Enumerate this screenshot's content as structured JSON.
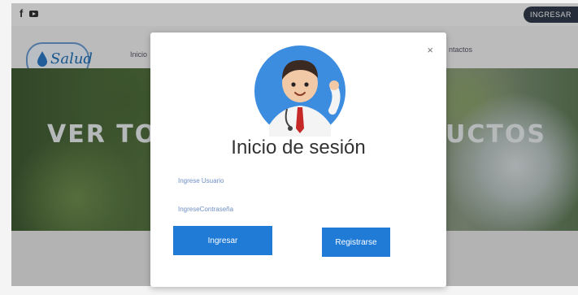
{
  "topbar": {
    "facebook_icon": "facebook-icon",
    "youtube_icon": "youtube-icon",
    "login_button": "INGRESAR"
  },
  "nav": {
    "brand": "Salud",
    "link_partial": "Inicio",
    "link_contact": "ntactos"
  },
  "hero": {
    "text_left": "VER TO",
    "text_right": "UCTOS"
  },
  "modal": {
    "close_label": "×",
    "title": "Inicio de sesión",
    "user_placeholder": "Ingrese Usuario",
    "password_placeholder": "IngreseContraseña",
    "login_button": "Ingresar",
    "register_button": "Registrarse"
  },
  "colors": {
    "accent": "#1f7bd6",
    "login_top_bg": "#2f3a4a",
    "avatar_bg": "#3c8ce0"
  }
}
